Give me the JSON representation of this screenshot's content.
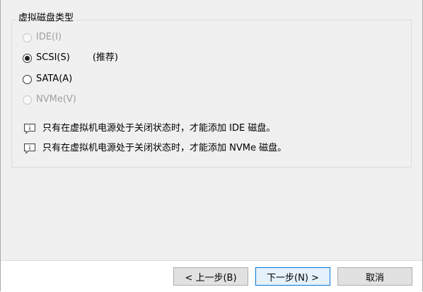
{
  "group": {
    "title": "虚拟磁盘类型"
  },
  "options": [
    {
      "label": "IDE(I)",
      "checked": false,
      "disabled": true
    },
    {
      "label": "SCSI(S)",
      "checked": true,
      "disabled": false,
      "note": "(推荐)"
    },
    {
      "label": "SATA(A)",
      "checked": false,
      "disabled": false
    },
    {
      "label": "NVMe(V)",
      "checked": false,
      "disabled": true
    }
  ],
  "notes": [
    {
      "icon": "info-icon",
      "text": "只有在虚拟机电源处于关闭状态时，才能添加 IDE 磁盘。"
    },
    {
      "icon": "info-icon",
      "text": "只有在虚拟机电源处于关闭状态时，才能添加 NVMe 磁盘。"
    }
  ],
  "buttons": {
    "back": "< 上一步(B)",
    "next": "下一步(N) >",
    "cancel": "取消"
  },
  "colors": {
    "panel_bg": "#f0f0f0",
    "footer_bg": "#ffffff",
    "disabled_text": "#a0a0a0",
    "focus_border": "#0078d7",
    "button_bg": "#e1e1e1"
  }
}
